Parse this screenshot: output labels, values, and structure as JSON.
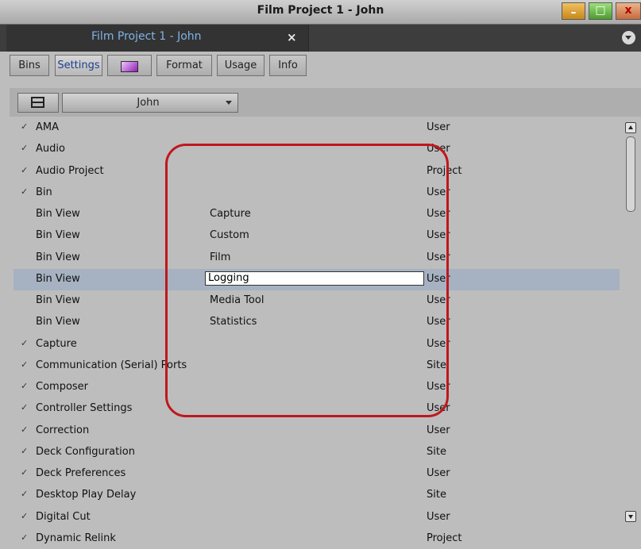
{
  "window": {
    "title": "Film Project 1 - John",
    "controls": {
      "minimize_glyph": "–",
      "maximize_glyph": "□",
      "close_glyph": "x"
    }
  },
  "doc_tab": {
    "label": "Film Project 1 - John",
    "close_glyph": "×"
  },
  "subtabs": [
    {
      "label": "Bins"
    },
    {
      "label": "Settings",
      "active": true
    },
    {
      "label": "",
      "icon": "color-swatch-icon"
    },
    {
      "label": "Format"
    },
    {
      "label": "Usage"
    },
    {
      "label": "Info"
    }
  ],
  "toolbar": {
    "view_icon": "frame-icon",
    "user_value": "John"
  },
  "settings": {
    "rows": [
      {
        "check": true,
        "name": "AMA",
        "sub": "",
        "kind": "User"
      },
      {
        "check": true,
        "name": "Audio",
        "sub": "",
        "kind": "User"
      },
      {
        "check": true,
        "name": "Audio Project",
        "sub": "",
        "kind": "Project"
      },
      {
        "check": true,
        "name": "Bin",
        "sub": "",
        "kind": "User"
      },
      {
        "check": false,
        "name": "Bin View",
        "sub": "Capture",
        "kind": "User"
      },
      {
        "check": false,
        "name": "Bin View",
        "sub": "Custom",
        "kind": "User"
      },
      {
        "check": false,
        "name": "Bin View",
        "sub": "Film",
        "kind": "User"
      },
      {
        "check": false,
        "name": "Bin View",
        "sub": "Logging",
        "kind": "User",
        "editing": true
      },
      {
        "check": false,
        "name": "Bin View",
        "sub": "Media Tool",
        "kind": "User"
      },
      {
        "check": false,
        "name": "Bin View",
        "sub": "Statistics",
        "kind": "User"
      },
      {
        "check": true,
        "name": "Capture",
        "sub": "",
        "kind": "User"
      },
      {
        "check": true,
        "name": "Communication (Serial) Ports",
        "sub": "",
        "kind": "Site"
      },
      {
        "check": true,
        "name": "Composer",
        "sub": "",
        "kind": "User"
      },
      {
        "check": true,
        "name": "Controller Settings",
        "sub": "",
        "kind": "User"
      },
      {
        "check": true,
        "name": "Correction",
        "sub": "",
        "kind": "User"
      },
      {
        "check": true,
        "name": "Deck Configuration",
        "sub": "",
        "kind": "Site"
      },
      {
        "check": true,
        "name": "Deck Preferences",
        "sub": "",
        "kind": "User"
      },
      {
        "check": true,
        "name": "Desktop Play Delay",
        "sub": "",
        "kind": "Site"
      },
      {
        "check": true,
        "name": "Digital Cut",
        "sub": "",
        "kind": "User"
      },
      {
        "check": true,
        "name": "Dynamic Relink",
        "sub": "",
        "kind": "Project"
      }
    ]
  },
  "check_glyph": "✓",
  "colors": {
    "annotation": "#c0171c",
    "selected_row": "#a6b2c2",
    "tab_text": "#7fb3e8"
  }
}
